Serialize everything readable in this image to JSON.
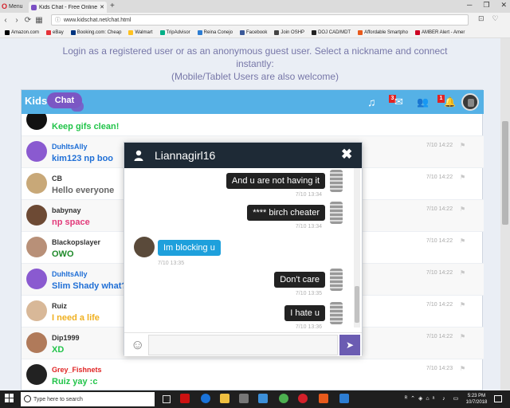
{
  "browser": {
    "menu_label": "Menu",
    "tab_title": "Kids Chat - Free Online Ch",
    "tab_close": "✕",
    "new_tab": "+",
    "url": "www.kidschat.net/chat.html",
    "bookmarks": [
      "Amazon.com",
      "eBay",
      "Booking.com: Cheap",
      "Walmart",
      "TripAdvisor",
      "Reina Conejo",
      "Facebook",
      "Join OSHP",
      "DOJ CAD/MDT",
      "Affordable Smartpho",
      "AMBER Alert - Amer"
    ]
  },
  "page": {
    "intro_line1": "Login as a registered user or as an anonymous guest user. Select a nickname and connect instantly:",
    "intro_line2": "(Mobile/Tablet Users are also welcome)"
  },
  "chat_header": {
    "logo_kids": "Kids",
    "logo_chat": "Chat",
    "badge_messages": "3",
    "badge_alerts": "1"
  },
  "messages": [
    {
      "user": "",
      "text": "Keep gifs clean!",
      "time": "",
      "user_color": "#000000",
      "text_color": "#22c44a"
    },
    {
      "user": "DuhItsAlly",
      "text": "kim123 np boo",
      "time": "7/10 14:22",
      "user_color": "#1f6fd6",
      "text_color": "#1f6fd6"
    },
    {
      "user": "CB",
      "text": "Hello everyone",
      "time": "7/10 14:22",
      "user_color": "#333333",
      "text_color": "#666666"
    },
    {
      "user": "babynay",
      "text": "np space",
      "time": "7/10 14:22",
      "user_color": "#333333",
      "text_color": "#e23a7a"
    },
    {
      "user": "Blackopslayer",
      "text": "OWO",
      "time": "7/10 14:22",
      "user_color": "#333333",
      "text_color": "#1f8a2a"
    },
    {
      "user": "DuhItsAlly",
      "text": "Slim Shady what?",
      "time": "7/10 14:22",
      "user_color": "#1f6fd6",
      "text_color": "#1f6fd6"
    },
    {
      "user": "Ruiz",
      "text": "I need a life",
      "time": "7/10 14:22",
      "user_color": "#333333",
      "text_color": "#f0b020"
    },
    {
      "user": "Dip1999",
      "text": "XD",
      "time": "7/10 14:22",
      "user_color": "#333333",
      "text_color": "#22c44a"
    },
    {
      "user": "Grey_Fishnets",
      "text": "Ruiz yay :c",
      "time": "7/10 14:23",
      "user_color": "#e02424",
      "text_color": "#22c44a"
    }
  ],
  "pm": {
    "title": "Liannagirl16",
    "close": "✖",
    "input_placeholder": "",
    "send_icon": "➤",
    "emoji_icon": "☺",
    "messages": [
      {
        "from": "me",
        "text": "And u are not having it",
        "time": "7/10 13:34"
      },
      {
        "from": "me",
        "text": "**** birch cheater",
        "time": "7/10 13:34"
      },
      {
        "from": "them",
        "text": "Im blocking u",
        "time": "7/10 13:35"
      },
      {
        "from": "me",
        "text": "Don't care",
        "time": "7/10 13:35"
      },
      {
        "from": "me",
        "text": "I hate u",
        "time": "7/10 13:36"
      }
    ]
  },
  "taskbar": {
    "search_placeholder": "Type here to search",
    "clock_time": "5:23 PM",
    "clock_date": "10/7/2018"
  }
}
